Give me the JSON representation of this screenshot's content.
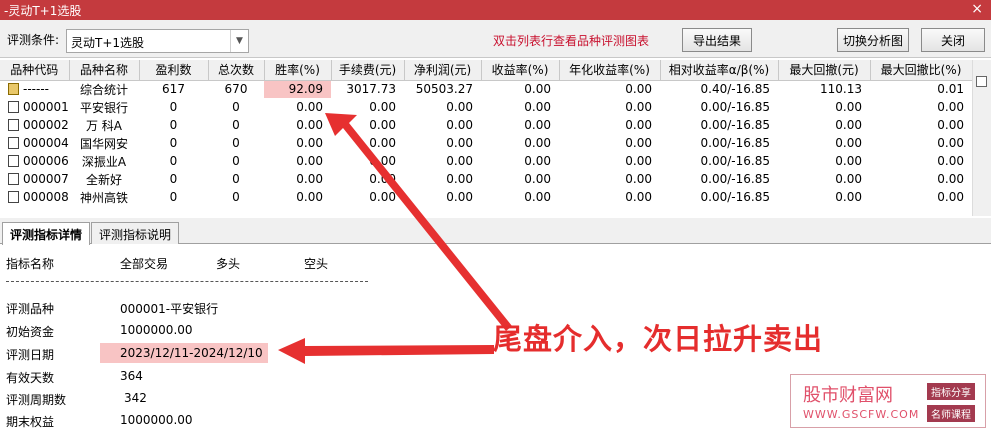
{
  "window": {
    "title": "-灵动T+1选股",
    "close_glyph": "×"
  },
  "toolbar": {
    "condition_label": "评测条件:",
    "condition_value": "灵动T+1选股",
    "hint": "双击列表行查看品种评测图表",
    "export_label": "导出结果",
    "switch_label": "切换分析图",
    "close_label": "关闭"
  },
  "table": {
    "headers": [
      "品种代码",
      "品种名称",
      "盈利数",
      "总次数",
      "胜率(%)",
      "手续费(元)",
      "净利润(元)",
      "收益率(%)",
      "年化收益率(%)",
      "相对收益率α/β(%)",
      "最大回撤(元)",
      "最大回撤比(%)"
    ],
    "rows": [
      [
        "------",
        "综合统计",
        "617",
        "670",
        "92.09",
        "3017.73",
        "50503.27",
        "0.00",
        "0.00",
        "0.40/-16.85",
        "110.13",
        "0.01"
      ],
      [
        "000001",
        "平安银行",
        "0",
        "0",
        "0.00",
        "0.00",
        "0.00",
        "0.00",
        "0.00",
        "0.00/-16.85",
        "0.00",
        "0.00"
      ],
      [
        "000002",
        "万 科A",
        "0",
        "0",
        "0.00",
        "0.00",
        "0.00",
        "0.00",
        "0.00",
        "0.00/-16.85",
        "0.00",
        "0.00"
      ],
      [
        "000004",
        "国华网安",
        "0",
        "0",
        "0.00",
        "0.00",
        "0.00",
        "0.00",
        "0.00",
        "0.00/-16.85",
        "0.00",
        "0.00"
      ],
      [
        "000006",
        "深振业A",
        "0",
        "0",
        "0.00",
        "0.00",
        "0.00",
        "0.00",
        "0.00",
        "0.00/-16.85",
        "0.00",
        "0.00"
      ],
      [
        "000007",
        "全新好",
        "0",
        "0",
        "0.00",
        "0.00",
        "0.00",
        "0.00",
        "0.00",
        "0.00/-16.85",
        "0.00",
        "0.00"
      ],
      [
        "000008",
        "神州高铁",
        "0",
        "0",
        "0.00",
        "0.00",
        "0.00",
        "0.00",
        "0.00",
        "0.00/-16.85",
        "0.00",
        "0.00"
      ]
    ]
  },
  "tabs": [
    {
      "label": "评测指标详情",
      "active": true
    },
    {
      "label": "评测指标说明",
      "active": false
    }
  ],
  "detail": {
    "col_headers": [
      "指标名称",
      "全部交易",
      "多头",
      "空头"
    ],
    "rows": [
      {
        "name": "评测品种",
        "value": "000001-平安银行"
      },
      {
        "name": "初始资金",
        "value": "1000000.00"
      },
      {
        "name": "评测日期",
        "value": "2023/12/11-2024/12/10"
      },
      {
        "name": "有效天数",
        "value": "364"
      },
      {
        "name": "评测周期数",
        "value": "342"
      },
      {
        "name": "期末权益",
        "value": "1000000.00"
      }
    ]
  },
  "callout": {
    "text": "尾盘介入，次日拉升卖出",
    "color": "#e52d2d"
  },
  "watermark": {
    "brand": "股市财富网",
    "url": "WWW.GSCFW.COM",
    "badge1": "指标分享",
    "badge2": "名师课程"
  },
  "colors": {
    "titlebar": "#c43a3e",
    "highlight": "#f8c4c4",
    "hint": "#c8102e"
  }
}
